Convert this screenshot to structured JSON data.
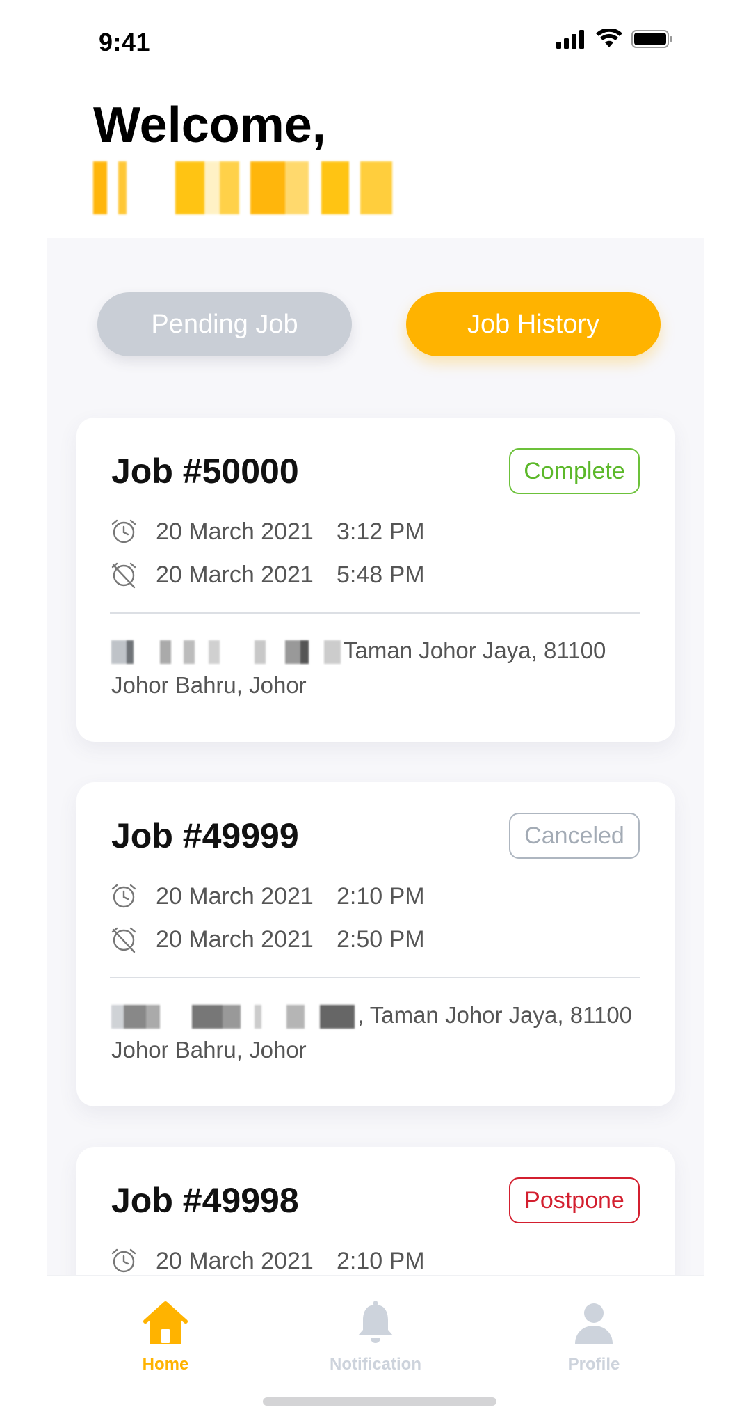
{
  "status_bar": {
    "time": "9:41"
  },
  "header": {
    "welcome": "Welcome,"
  },
  "tabs": {
    "pending": "Pending Job",
    "history": "Job History"
  },
  "jobs": [
    {
      "title": "Job #50000",
      "status": "Complete",
      "start_date": "20 March 2021",
      "start_time": "3:12 PM",
      "end_date": "20 March 2021",
      "end_time": "5:48 PM",
      "address_line1": "Taman Johor Jaya, 81100",
      "address_line2": "Johor Bahru, Johor"
    },
    {
      "title": "Job #49999",
      "status": "Canceled",
      "start_date": "20 March 2021",
      "start_time": "2:10 PM",
      "end_date": "20 March 2021",
      "end_time": "2:50 PM",
      "address_line1": ", Taman Johor Jaya, 81100",
      "address_line2": "Johor Bahru, Johor"
    },
    {
      "title": "Job #49998",
      "status": "Postpone",
      "start_date": "20 March 2021",
      "start_time": "2:10 PM"
    }
  ],
  "bottom_nav": {
    "home": "Home",
    "notification": "Notification",
    "profile": "Profile"
  },
  "colors": {
    "accent": "#ffb300",
    "complete": "#5cb82a",
    "canceled": "#a3abb5",
    "postpone": "#d31f2f",
    "inactive": "#cdd3dc"
  },
  "icons": [
    "signal-icon",
    "wifi-icon",
    "battery-icon",
    "clock-icon",
    "alarm-off-icon",
    "home-icon",
    "bell-icon",
    "profile-icon"
  ]
}
